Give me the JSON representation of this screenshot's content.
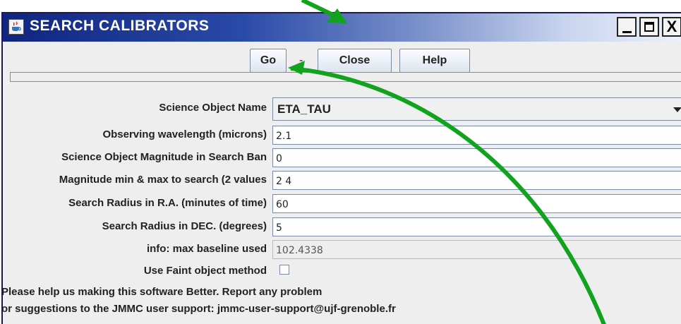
{
  "window": {
    "title": "SEARCH CALIBRATORS",
    "icon": "java-cup-icon",
    "controls": {
      "minimize": "_",
      "maximize": "□",
      "close": "X"
    }
  },
  "toolbar": {
    "go_label": "Go",
    "separator": "-",
    "close_label": "Close",
    "help_label": "Help"
  },
  "form": {
    "science_object_name": {
      "label": "Science Object Name",
      "value": "ETA_TAU"
    },
    "wavelength": {
      "label": "Observing wavelength (microns)",
      "value": "2.1"
    },
    "magnitude": {
      "label": "Science Object Magnitude in Search Ban",
      "value": "0"
    },
    "mag_range": {
      "label": "Magnitude min & max to search (2 values",
      "value": "2 4"
    },
    "radius_ra": {
      "label": "Search Radius in R.A. (minutes of time)",
      "value": "60"
    },
    "radius_dec": {
      "label": "Search Radius in DEC. (degrees)",
      "value": "5"
    },
    "baseline": {
      "label": "info: max baseline used",
      "value": "102.4338"
    },
    "faint": {
      "label": "Use Faint object method",
      "checked": false
    }
  },
  "footer": {
    "line1": "Please help us making this software Better. Report any problem",
    "line2": "or suggestions to the JMMC user support: jmmc-user-support@ujf-grenoble.fr"
  },
  "colors": {
    "annotation_arrow": "#11a31d",
    "titlebar_start": "#0f2580",
    "titlebar_end": "#eef2fb"
  }
}
